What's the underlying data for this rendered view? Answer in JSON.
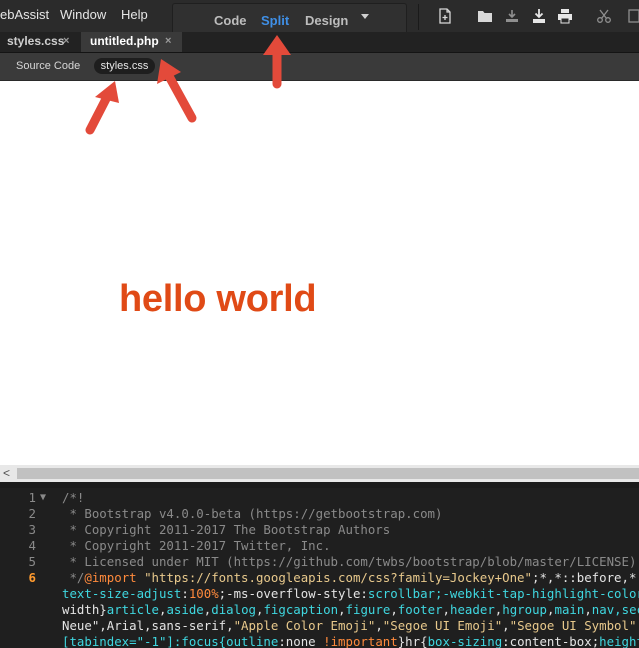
{
  "menubar": {
    "items": [
      "ebAssist",
      "Window",
      "Help"
    ]
  },
  "view_switcher": {
    "code_label": "Code",
    "split_label": "Split",
    "design_label": "Design",
    "active": "Split",
    "active_color": "#3f8fe6"
  },
  "toolbar": {
    "icons": [
      "new-file-icon",
      "open-folder-icon",
      "get-file-icon",
      "put-file-icon",
      "print-icon",
      "cut-icon"
    ]
  },
  "tabs": [
    {
      "label": "styles.css",
      "close": "×",
      "active": false
    },
    {
      "label": "untitled.php",
      "close": "×",
      "active": true
    }
  ],
  "related_files": {
    "source_label": "Source Code",
    "items": [
      "styles.css"
    ]
  },
  "live_view": {
    "heading": "hello world",
    "heading_color": "#e04a16"
  },
  "scrollbar": {
    "left_arrow": "<"
  },
  "code_editor": {
    "current_line": "6",
    "lines": [
      {
        "num": "1",
        "fold": "▼",
        "text": "/*!"
      },
      {
        "num": "2",
        "fold": "",
        "text": " * Bootstrap v4.0.0-beta (https://getbootstrap.com)"
      },
      {
        "num": "3",
        "fold": "",
        "text": " * Copyright 2011-2017 The Bootstrap Authors"
      },
      {
        "num": "4",
        "fold": "",
        "text": " * Copyright 2011-2017 Twitter, Inc."
      },
      {
        "num": "5",
        "fold": "",
        "text": " * Licensed under MIT (https://github.com/twbs/bootstrap/blob/master/LICENSE)"
      },
      {
        "num": "6",
        "fold": "",
        "parts": [
          {
            "t": " */",
            "c": "c-comment"
          },
          {
            "t": "@import",
            "c": "c-at"
          },
          {
            "t": " \"https://fonts.googleapis.com/css?family=Jockey+One\"",
            "c": "c-str"
          },
          {
            "t": ";*,*::before,*::after{box-sizing:border-box}",
            "c": "c-plain"
          }
        ]
      },
      {
        "num": "",
        "fold": "",
        "parts": [
          {
            "t": "text-size-adjust",
            "c": "c-kw"
          },
          {
            "t": ":",
            "c": "c-plain"
          },
          {
            "t": "100%",
            "c": "c-val"
          },
          {
            "t": ";-ms-overflow-style:",
            "c": "c-plain"
          },
          {
            "t": "scrollbar",
            "c": "c-kw"
          },
          {
            "t": ";-webkit-tap-highlight-color:transparent}",
            "c": "c-kw"
          }
        ]
      },
      {
        "num": "",
        "fold": "",
        "parts": [
          {
            "t": "width}",
            "c": "c-plain"
          },
          {
            "t": "article",
            "c": "c-kw"
          },
          {
            "t": ",",
            "c": "c-plain"
          },
          {
            "t": "aside",
            "c": "c-kw"
          },
          {
            "t": ",",
            "c": "c-plain"
          },
          {
            "t": "dialog",
            "c": "c-kw"
          },
          {
            "t": ",",
            "c": "c-plain"
          },
          {
            "t": "figcaption",
            "c": "c-kw"
          },
          {
            "t": ",",
            "c": "c-plain"
          },
          {
            "t": "figure",
            "c": "c-kw"
          },
          {
            "t": ",",
            "c": "c-plain"
          },
          {
            "t": "footer",
            "c": "c-kw"
          },
          {
            "t": ",",
            "c": "c-plain"
          },
          {
            "t": "header",
            "c": "c-kw"
          },
          {
            "t": ",",
            "c": "c-plain"
          },
          {
            "t": "hgroup",
            "c": "c-kw"
          },
          {
            "t": ",",
            "c": "c-plain"
          },
          {
            "t": "main",
            "c": "c-kw"
          },
          {
            "t": ",",
            "c": "c-plain"
          },
          {
            "t": "nav,section",
            "c": "c-kw"
          }
        ]
      },
      {
        "num": "",
        "fold": "",
        "parts": [
          {
            "t": "Neue\",Arial,sans-serif,",
            "c": "c-plain"
          },
          {
            "t": "\"Apple Color Emoji\"",
            "c": "c-str"
          },
          {
            "t": ",",
            "c": "c-plain"
          },
          {
            "t": "\"Segoe UI Emoji\"",
            "c": "c-str"
          },
          {
            "t": ",",
            "c": "c-plain"
          },
          {
            "t": "\"Segoe UI Symbol\"",
            "c": "c-str"
          }
        ]
      },
      {
        "num": "",
        "fold": "",
        "parts": [
          {
            "t": "[tabindex=\"-1\"]:focus{",
            "c": "c-kw"
          },
          {
            "t": "outline",
            "c": "c-kw"
          },
          {
            "t": ":none ",
            "c": "c-plain"
          },
          {
            "t": "!important",
            "c": "c-val"
          },
          {
            "t": "}hr{",
            "c": "c-plain"
          },
          {
            "t": "box-sizing",
            "c": "c-kw"
          },
          {
            "t": ":content-box;",
            "c": "c-plain"
          },
          {
            "t": "height",
            "c": "c-kw"
          }
        ]
      }
    ]
  }
}
